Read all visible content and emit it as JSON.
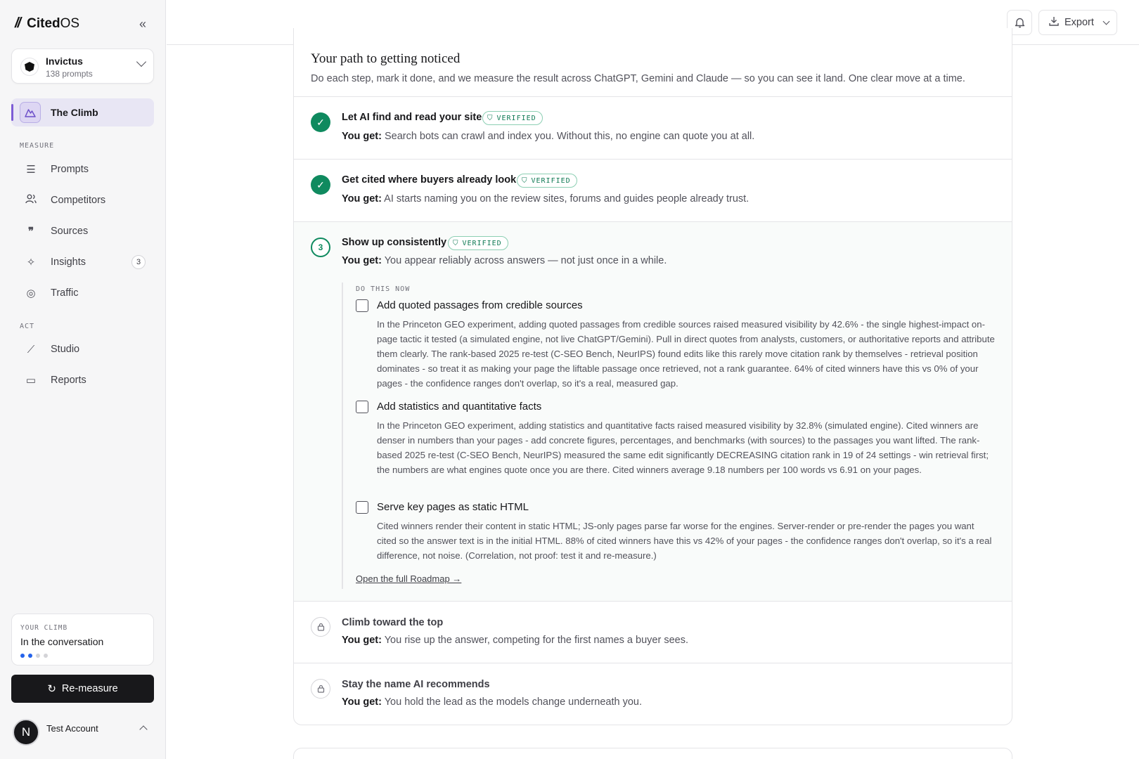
{
  "brand": {
    "mark": "//",
    "name_bold": "Cited",
    "name_rest": "OS"
  },
  "workspace": {
    "name": "Invictus",
    "sub": "138 prompts"
  },
  "nav": {
    "active": {
      "label": "The Climb"
    },
    "measure_label": "MEASURE",
    "measure": [
      {
        "label": "Prompts",
        "icon": "list-check-icon"
      },
      {
        "label": "Competitors",
        "icon": "users-icon"
      },
      {
        "label": "Sources",
        "icon": "quote-icon"
      },
      {
        "label": "Insights",
        "icon": "sparkles-icon",
        "badge": "3"
      },
      {
        "label": "Traffic",
        "icon": "radar-icon"
      }
    ],
    "act_label": "ACT",
    "act": [
      {
        "label": "Studio",
        "icon": "wand-icon"
      },
      {
        "label": "Reports",
        "icon": "presentation-icon"
      }
    ]
  },
  "climb": {
    "label": "YOUR CLIMB",
    "value": "In the conversation",
    "progress": 2,
    "total": 4
  },
  "remeasure": {
    "label": "Re-measure"
  },
  "account": {
    "initial": "N",
    "name": "Test Account"
  },
  "topbar": {
    "export_label": "Export"
  },
  "card": {
    "title": "Your path to getting noticed",
    "desc": "Do each step, mark it done, and we measure the result across ChatGPT, Gemini and Claude — so you can see it land. One clear move at a time."
  },
  "you_get_label": "You get:",
  "verified_label": "VERIFIED",
  "steps": [
    {
      "title": "Let AI find and read your site",
      "get": "Search bots can crawl and index you. Without this, no engine can quote you at all.",
      "status": "done"
    },
    {
      "title": "Get cited where buyers already look",
      "get": "AI starts naming you on the review sites, forums and guides people already trust.",
      "status": "done"
    },
    {
      "number": "3",
      "title": "Show up consistently",
      "get": "You appear reliably across answers — not just once in a while.",
      "status": "current"
    },
    {
      "title": "Climb toward the top",
      "get": "You rise up the answer, competing for the first names a buyer sees.",
      "status": "locked"
    },
    {
      "title": "Stay the name AI recommends",
      "get": "You hold the lead as the models change underneath you.",
      "status": "locked"
    }
  ],
  "do_now": {
    "label": "DO THIS NOW",
    "tasks": [
      {
        "title": "Add quoted passages from credible sources",
        "desc": "In the Princeton GEO experiment, adding quoted passages from credible sources raised measured visibility by 42.6% - the single highest-impact on-page tactic it tested (a simulated engine, not live ChatGPT/Gemini). Pull in direct quotes from analysts, customers, or authoritative reports and attribute them clearly. The rank-based 2025 re-test (C-SEO Bench, NeurIPS) found edits like this rarely move citation rank by themselves - retrieval position dominates - so treat it as making your page the liftable passage once retrieved, not a rank guarantee. 64% of cited winners have this vs 0% of your pages - the confidence ranges don't overlap, so it's a real, measured gap."
      },
      {
        "title": "Add statistics and quantitative facts",
        "desc": "In the Princeton GEO experiment, adding statistics and quantitative facts raised measured visibility by 32.8% (simulated engine). Cited winners are denser in numbers than your pages - add concrete figures, percentages, and benchmarks (with sources) to the passages you want lifted. The rank-based 2025 re-test (C-SEO Bench, NeurIPS) measured the same edit significantly DECREASING citation rank in 19 of 24 settings - win retrieval first; the numbers are what engines quote once you are there. Cited winners average 9.18 numbers per 100 words vs 6.91 on your pages."
      },
      {
        "title": "Serve key pages as static HTML",
        "desc": "Cited winners render their content in static HTML; JS-only pages parse far worse for the engines. Server-render or pre-render the pages you want cited so the answer text is in the initial HTML. 88% of cited winners have this vs 42% of your pages - the confidence ranges don't overlap, so it's a real difference, not noise. (Correlation, not proof: test it and re-measure.)"
      }
    ],
    "link": "Open the full Roadmap →"
  }
}
